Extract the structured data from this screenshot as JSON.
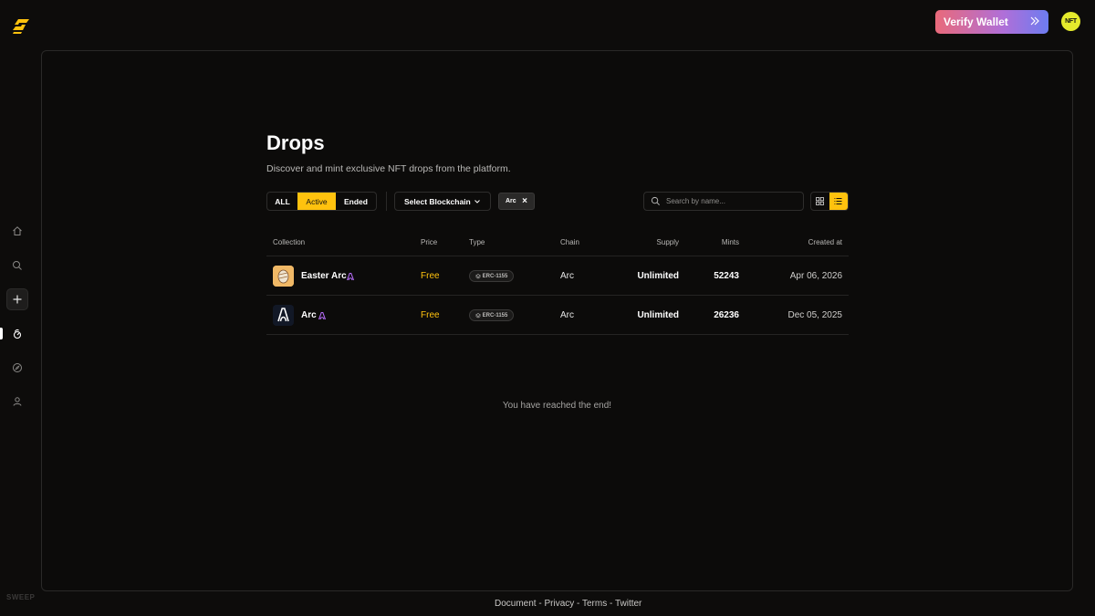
{
  "brand": {
    "footer_label": "SWEEP",
    "accent": "#ffc20e"
  },
  "header": {
    "verify_label": "Verify Wallet",
    "avatar_text": "NFT"
  },
  "sidebar": {
    "items": [
      {
        "icon": "home-icon"
      },
      {
        "icon": "search-icon"
      },
      {
        "icon": "plus-icon"
      },
      {
        "icon": "drops-icon",
        "active": true
      },
      {
        "icon": "compass-icon"
      },
      {
        "icon": "user-icon"
      }
    ]
  },
  "page": {
    "title": "Drops",
    "subtitle": "Discover and mint exclusive NFT drops from the platform."
  },
  "filters": {
    "status": {
      "all": "ALL",
      "active": "Active",
      "ended": "Ended",
      "selected": "Active"
    },
    "blockchain_select": "Select Blockchain",
    "chip": "Arc",
    "search_placeholder": "Search by name...",
    "view": "list"
  },
  "table": {
    "headers": {
      "collection": "Collection",
      "price": "Price",
      "type": "Type",
      "chain": "Chain",
      "supply": "Supply",
      "mints": "Mints",
      "created": "Created at"
    },
    "rows": [
      {
        "name": "Easter Arc",
        "price": "Free",
        "type": "ERC-1155",
        "chain": "Arc",
        "supply": "Unlimited",
        "mints": "52243",
        "created": "Apr 06, 2026"
      },
      {
        "name": "Arc",
        "price": "Free",
        "type": "ERC-1155",
        "chain": "Arc",
        "supply": "Unlimited",
        "mints": "26236",
        "created": "Dec 05, 2025"
      }
    ]
  },
  "end_message": "You have reached the end!",
  "footer": {
    "links": [
      "Document",
      "Privacy",
      "Terms",
      "Twitter"
    ],
    "separator": " - "
  }
}
